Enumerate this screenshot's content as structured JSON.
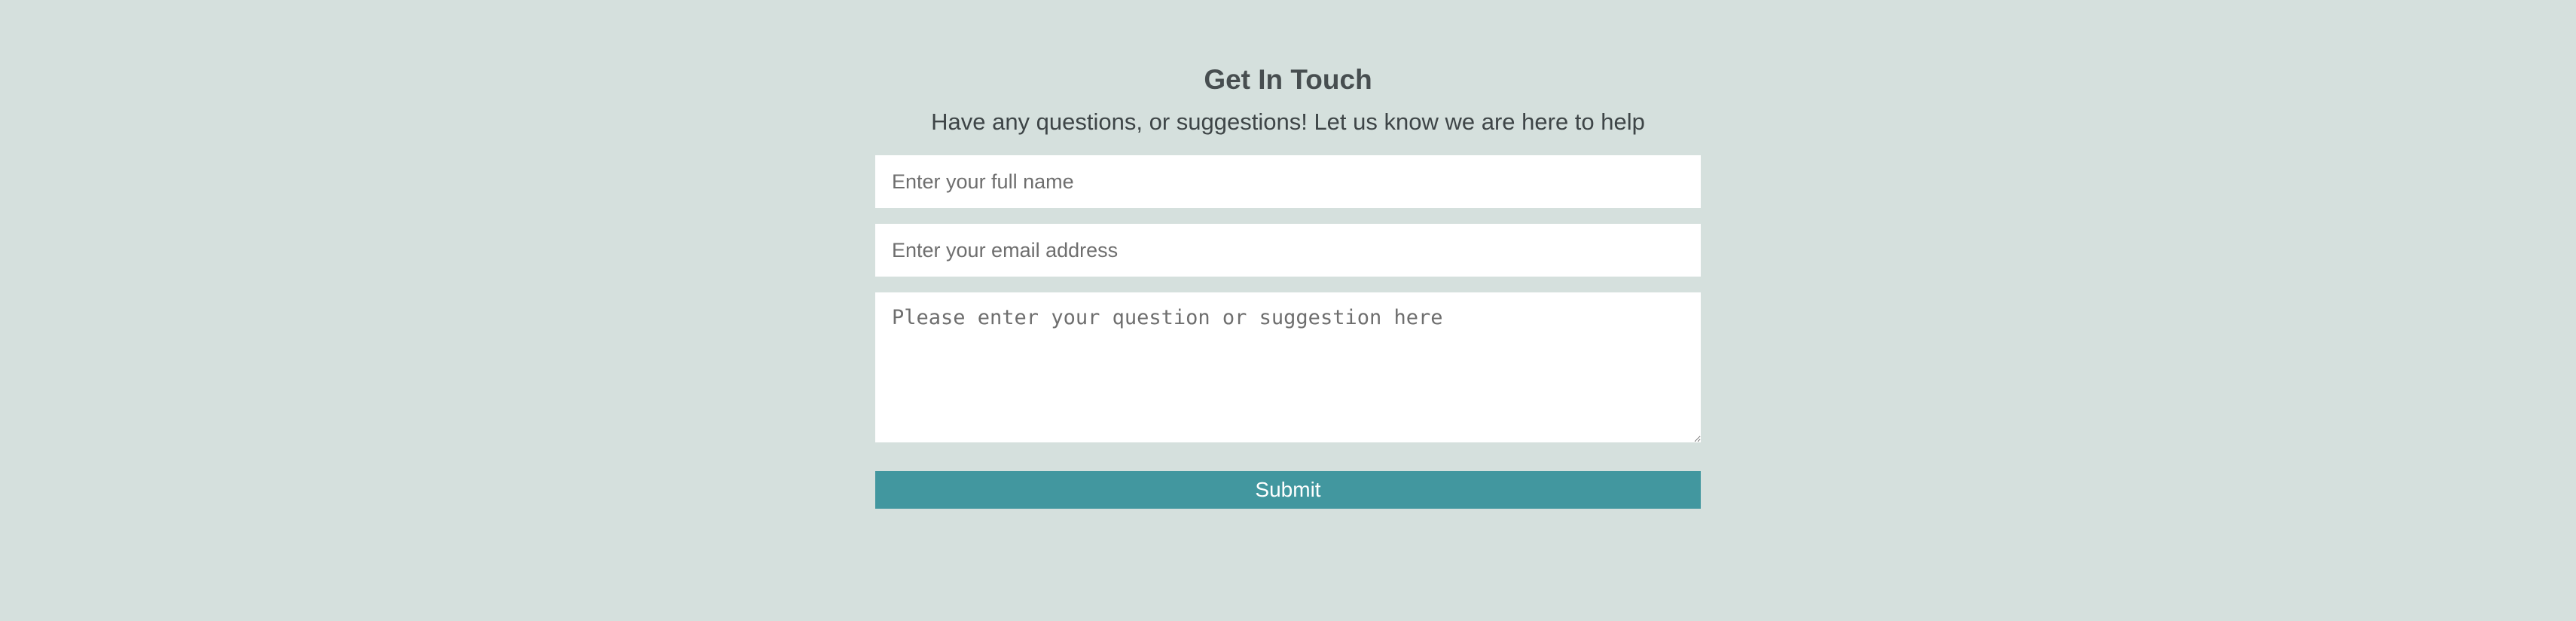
{
  "contact_form": {
    "title": "Get In Touch",
    "subtitle": "Have any questions, or suggestions! Let us know we are here to help",
    "name_field": {
      "placeholder": "Enter your full name",
      "value": ""
    },
    "email_field": {
      "placeholder": "Enter your email address",
      "value": ""
    },
    "message_field": {
      "placeholder": "Please enter your question or suggestion here",
      "value": ""
    },
    "submit_label": "Submit"
  },
  "colors": {
    "background": "#d5e0dd",
    "button": "#42979f",
    "title_text": "#474e50",
    "input_background": "#ffffff"
  }
}
